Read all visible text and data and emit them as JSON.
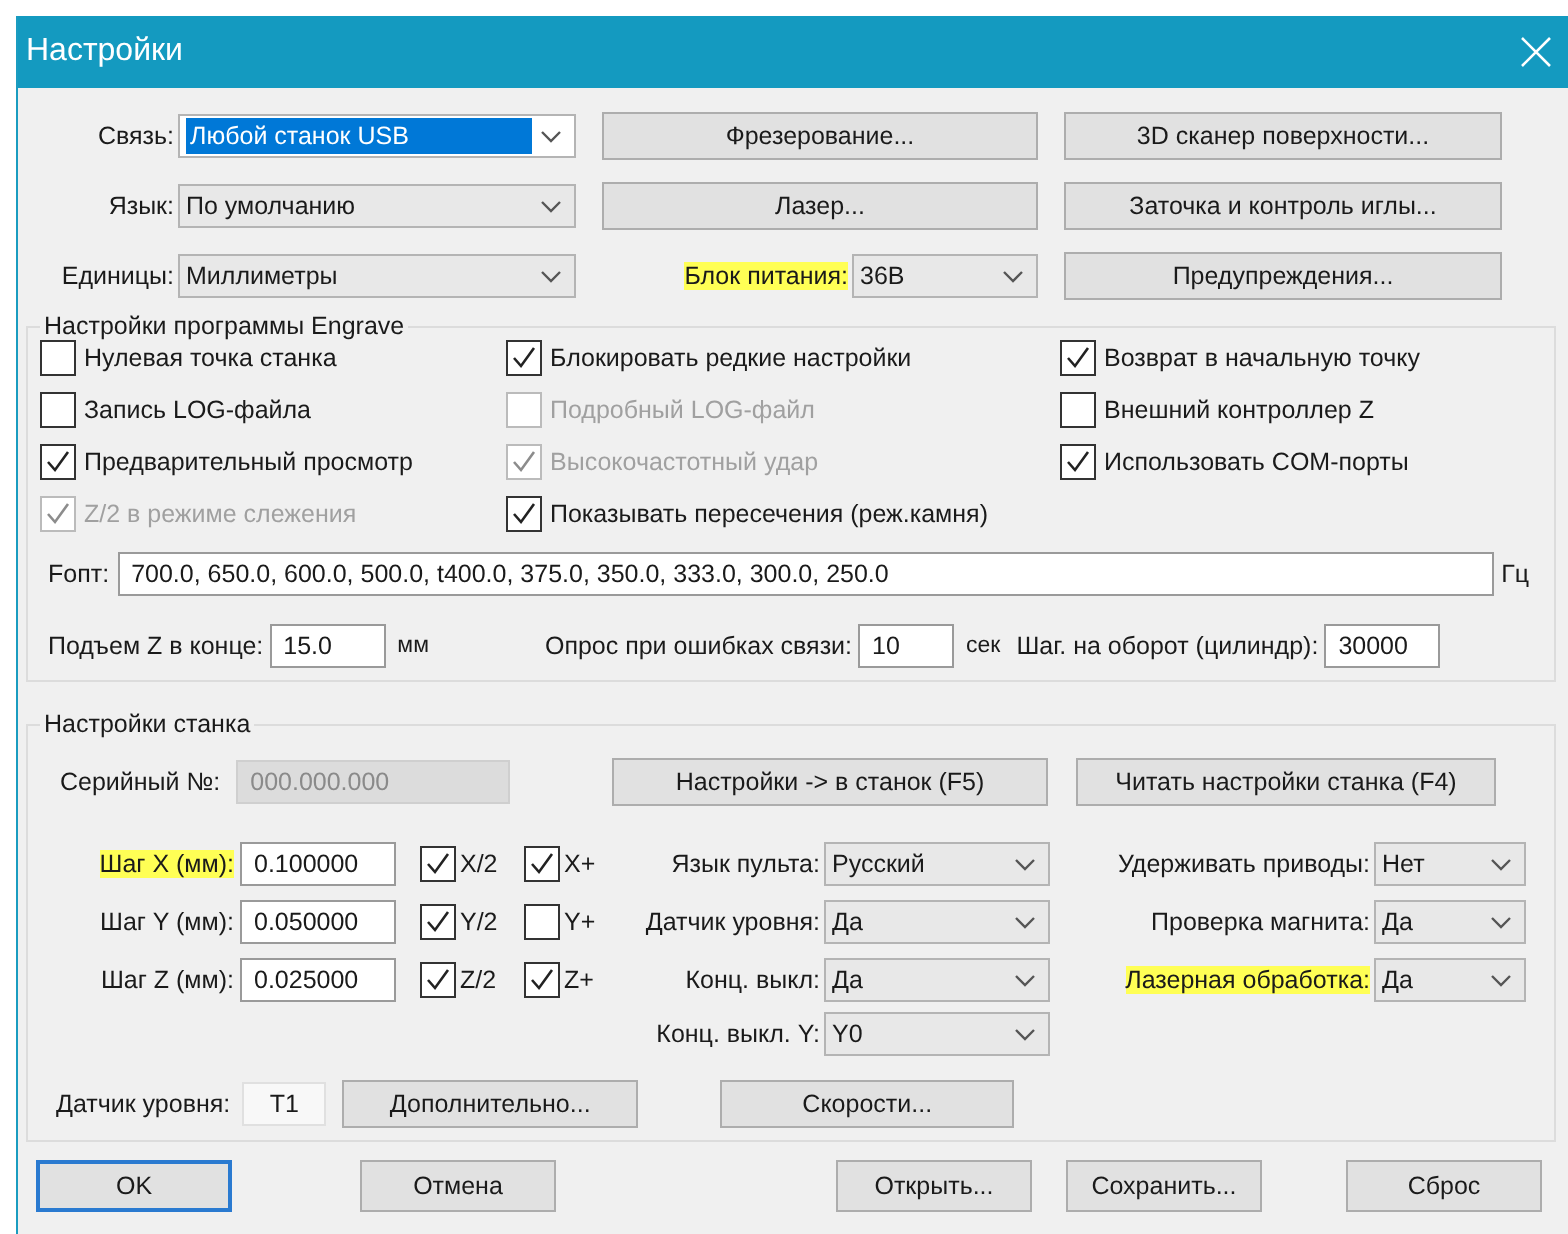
{
  "window": {
    "title": "Настройки"
  },
  "top_rows": [
    [
      {
        "kind": "combo",
        "label": "Связь:",
        "value": "Любой станок USB",
        "value_selected": true,
        "highlighted": false
      },
      {
        "kind": "button",
        "label": "Фрезерование..."
      },
      {
        "kind": "button",
        "label": "3D сканер поверхности..."
      }
    ],
    [
      {
        "kind": "combo",
        "label": "Язык:",
        "value": "По умолчанию",
        "value_selected": false,
        "highlighted": false
      },
      {
        "kind": "button",
        "label": "Лазер..."
      },
      {
        "kind": "button",
        "label": "Заточка и контроль иглы..."
      }
    ],
    [
      {
        "kind": "combo",
        "label": "Единицы:",
        "value": "Миллиметры",
        "value_selected": false,
        "highlighted": false
      },
      {
        "kind": "combo",
        "label": "Блок питания:",
        "value": "36В",
        "value_selected": false,
        "highlighted": true
      },
      {
        "kind": "button",
        "label": "Предупреждения..."
      }
    ]
  ],
  "program_group": {
    "title": "Настройки программы Engrave",
    "checkboxes": [
      [
        {
          "label": "Нулевая точка станка",
          "checked": false,
          "disabled": false
        },
        {
          "label": "Блокировать редкие настройки",
          "checked": true,
          "disabled": false
        },
        {
          "label": "Возврат в начальную точку",
          "checked": true,
          "disabled": false
        }
      ],
      [
        {
          "label": "Запись LOG-файла",
          "checked": false,
          "disabled": false
        },
        {
          "label": "Подробный LOG-файл",
          "checked": false,
          "disabled": true
        },
        {
          "label": "Внешний контроллер Z",
          "checked": false,
          "disabled": false
        }
      ],
      [
        {
          "label": "Предварительный просмотр",
          "checked": true,
          "disabled": false
        },
        {
          "label": "Высокочастотный удар",
          "checked": true,
          "disabled": true
        },
        {
          "label": "Использовать COM-порты",
          "checked": true,
          "disabled": false
        }
      ],
      [
        {
          "label": "Z/2 в режиме слежения",
          "checked": true,
          "disabled": true
        },
        {
          "label": "Показывать пересечения (реж.камня)",
          "checked": true,
          "disabled": false
        }
      ]
    ],
    "frequencies": {
      "label": "Fопт:",
      "value": "700.0, 650.0, 600.0, 500.0, t400.0, 375.0, 350.0, 333.0, 300.0, 250.0",
      "unit": "Гц"
    },
    "params": [
      {
        "label": "Подъем Z в конце:",
        "value": "15.0",
        "unit": "мм"
      },
      {
        "label": "Опрос при ошибках связи:",
        "value": "10",
        "unit": "сек"
      },
      {
        "label": "Шаг. на оборот (цилиндр):",
        "value": "30000"
      }
    ]
  },
  "machine_group": {
    "title": "Настройки станка",
    "serial": {
      "label": "Серийный №:",
      "value": "000.000.000",
      "disabled": true
    },
    "serial_buttons": [
      "Настройки -> в станок (F5)",
      "Читать настройки станка (F4)"
    ],
    "axis_rows": [
      {
        "label": "Шаг X (мм):",
        "value": "0.100000",
        "highlighted": true,
        "checkboxes": [
          {
            "label": "X/2",
            "checked": true
          },
          {
            "label": "X+",
            "checked": true
          }
        ],
        "combos": [
          {
            "label": "Язык пульта:",
            "value": "Русский",
            "highlighted": false
          },
          {
            "label": "Удерживать приводы:",
            "value": "Нет",
            "highlighted": false
          }
        ]
      },
      {
        "label": "Шаг Y (мм):",
        "value": "0.050000",
        "highlighted": false,
        "checkboxes": [
          {
            "label": "Y/2",
            "checked": true
          },
          {
            "label": "Y+",
            "checked": false
          }
        ],
        "combos": [
          {
            "label": "Датчик уровня:",
            "value": "Да",
            "highlighted": false
          },
          {
            "label": "Проверка магнита:",
            "value": "Да",
            "highlighted": false
          }
        ]
      },
      {
        "label": "Шаг Z (мм):",
        "value": "0.025000",
        "highlighted": false,
        "checkboxes": [
          {
            "label": "Z/2",
            "checked": true
          },
          {
            "label": "Z+",
            "checked": true
          }
        ],
        "combos": [
          {
            "label": "Конц. выкл:",
            "value": "Да",
            "highlighted": false
          },
          {
            "label": "Лазерная обработка:",
            "value": "Да",
            "highlighted": true
          }
        ]
      },
      {
        "combos": [
          {
            "label": "Конц. выкл. Y:",
            "value": "Y0",
            "highlighted": false
          }
        ]
      }
    ],
    "sensor": {
      "label": "Датчик уровня:",
      "value": "T1"
    },
    "sensor_buttons": [
      "Дополнительно...",
      "Скорости..."
    ]
  },
  "footer_buttons": [
    {
      "label": "OK",
      "focused": true
    },
    {
      "label": "Отмена",
      "focused": false
    },
    {
      "label": "Открыть...",
      "focused": false
    },
    {
      "label": "Сохранить...",
      "focused": false
    },
    {
      "label": "Сброс",
      "focused": false
    }
  ]
}
